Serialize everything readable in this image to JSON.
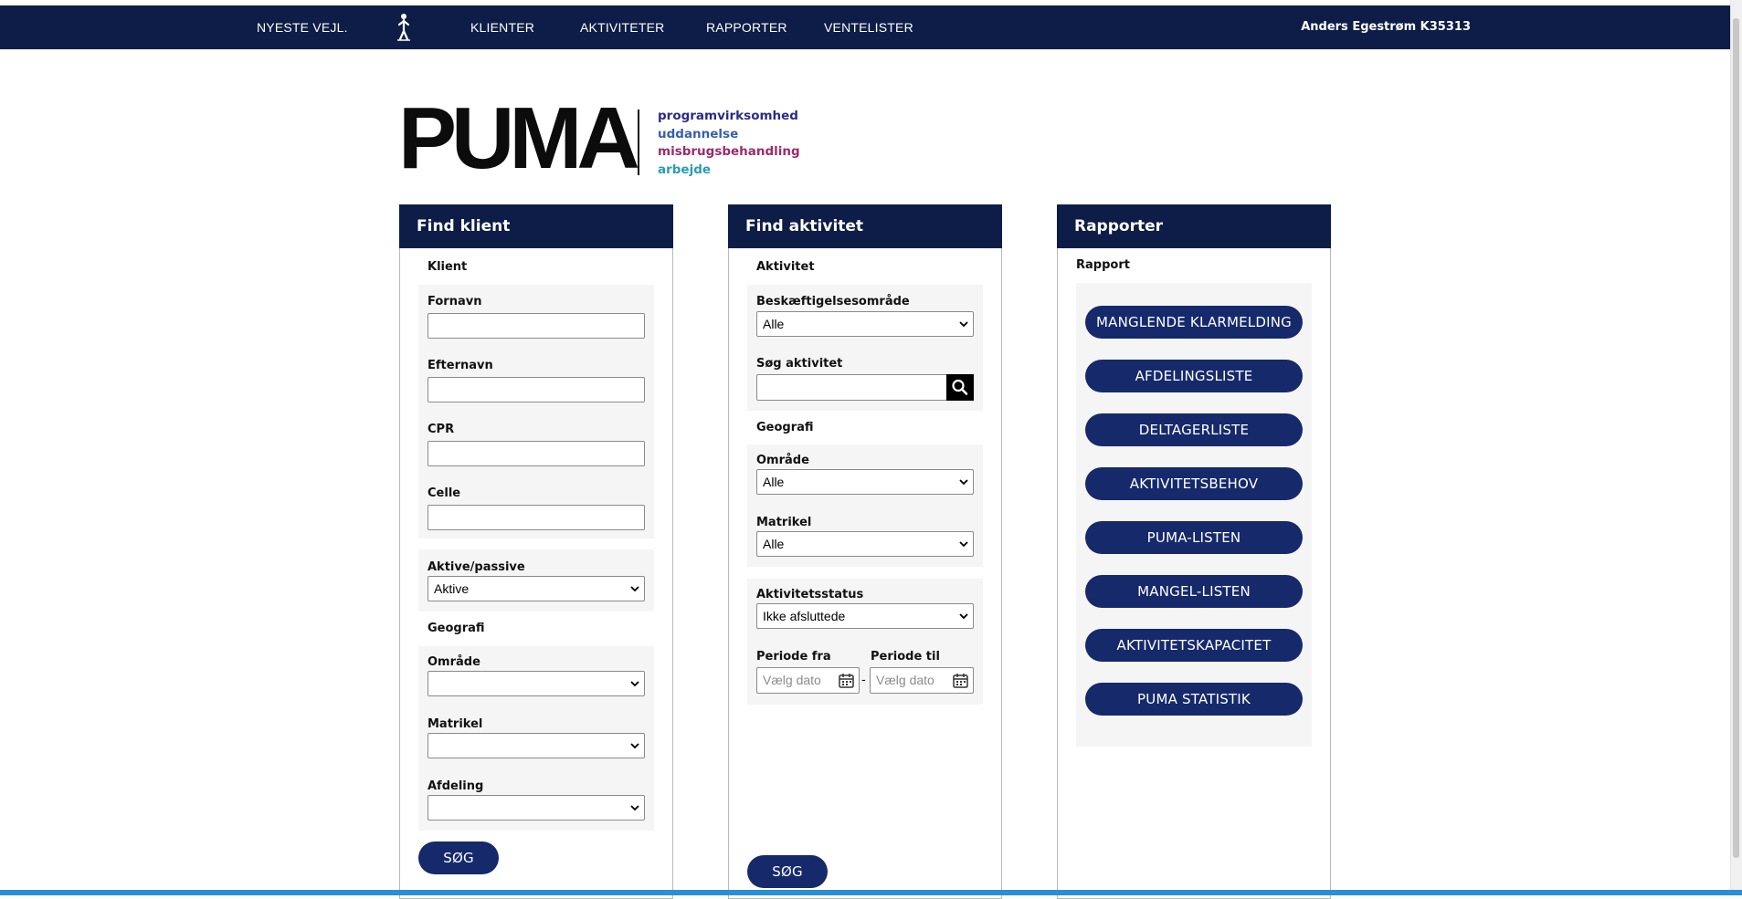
{
  "nav": {
    "items": [
      "NYESTE VEJL.",
      "KLIENTER",
      "AKTIVITETER",
      "RAPPORTER",
      "VENTELISTER"
    ],
    "user": "Anders Egestrøm K35313"
  },
  "logo": {
    "word": "PUMA",
    "tags": [
      {
        "text": "programvirksomhed",
        "color": "#2c2a86"
      },
      {
        "text": "uddannelse",
        "color": "#3a5fa8"
      },
      {
        "text": "misbrugsbehandling",
        "color": "#9b2c6a"
      },
      {
        "text": "arbejde",
        "color": "#2a9cb0"
      }
    ]
  },
  "find_klient": {
    "title": "Find klient",
    "section_klient": "Klient",
    "fornavn": {
      "label": "Fornavn",
      "value": ""
    },
    "efternavn": {
      "label": "Efternavn",
      "value": ""
    },
    "cpr": {
      "label": "CPR",
      "value": ""
    },
    "celle": {
      "label": "Celle",
      "value": ""
    },
    "aktive_passive": {
      "label": "Aktive/passive",
      "selected": "Aktive"
    },
    "section_geografi": "Geografi",
    "omraade": {
      "label": "Område",
      "selected": ""
    },
    "matrikel": {
      "label": "Matrikel",
      "selected": ""
    },
    "afdeling": {
      "label": "Afdeling",
      "selected": ""
    },
    "search_button": "SØG"
  },
  "find_aktivitet": {
    "title": "Find aktivitet",
    "section_aktivitet": "Aktivitet",
    "beskaeftigelse": {
      "label": "Beskæftigelsesområde",
      "selected": "Alle"
    },
    "soeg_aktivitet": {
      "label": "Søg aktivitet",
      "value": ""
    },
    "section_geografi": "Geografi",
    "omraade": {
      "label": "Område",
      "selected": "Alle"
    },
    "matrikel": {
      "label": "Matrikel",
      "selected": "Alle"
    },
    "status": {
      "label": "Aktivitetsstatus",
      "selected": "Ikke afsluttede"
    },
    "periode_fra": {
      "label": "Periode fra",
      "placeholder": "Vælg dato"
    },
    "periode_til": {
      "label": "Periode til",
      "placeholder": "Vælg dato"
    },
    "dash": "-",
    "search_button": "SØG"
  },
  "rapporter": {
    "title": "Rapporter",
    "section": "Rapport",
    "buttons": [
      "MANGLENDE KLARMELDING",
      "AFDELINGSLISTE",
      "DELTAGERLISTE",
      "AKTIVITETSBEHOV",
      "PUMA-LISTEN",
      "MANGEL-LISTEN",
      "AKTIVITETSKAPACITET",
      "PUMA STATISTIK"
    ]
  }
}
